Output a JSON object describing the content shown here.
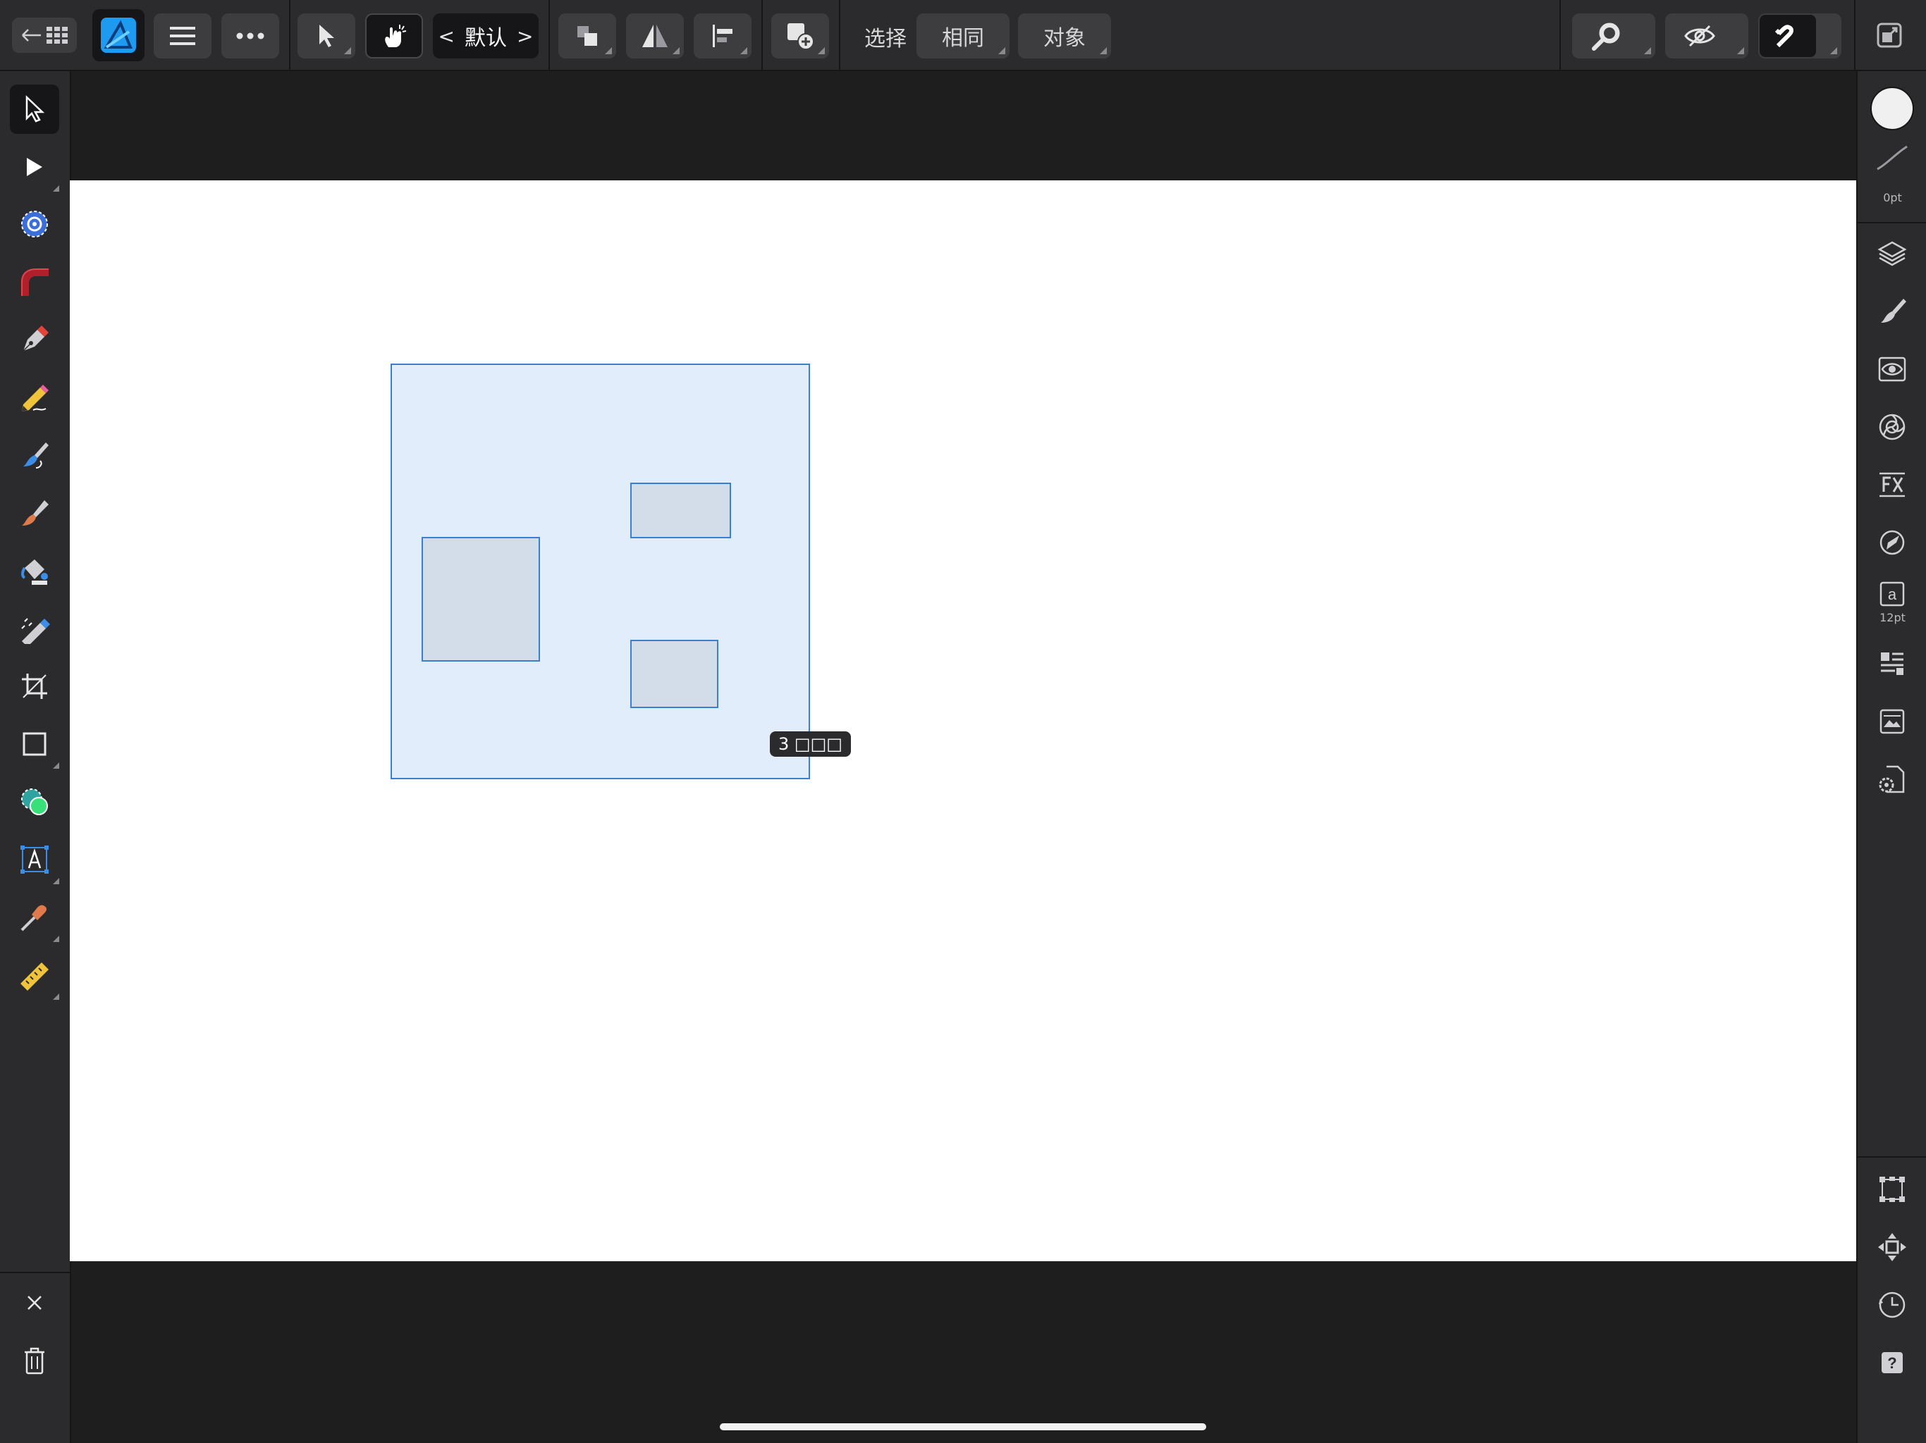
{
  "toolbar": {
    "persona_label": "默认",
    "select_label": "选择",
    "same_label": "相同",
    "object_label": "对象"
  },
  "right_panel": {
    "stroke_width": "0pt",
    "text_size": "12pt"
  },
  "canvas": {
    "selection_badge": "3 □□□"
  },
  "colors": {
    "accent": "#3b7fd0",
    "app_icon": "#1e9bf0",
    "toolbar_bg": "#2b2b2d",
    "canvas_bg": "#ffffff"
  },
  "icons": {
    "top": [
      "back-arrow-icon",
      "grid-icon",
      "affinity-designer-logo-icon",
      "hamburger-menu-icon",
      "more-dots-icon",
      "pointer-icon",
      "touch-gesture-icon",
      "arrange-icon",
      "flip-icon",
      "align-icon",
      "insert-icon",
      "zoom-icon",
      "view-mode-icon",
      "snapping-magnet-icon",
      "fullscreen-icon"
    ],
    "left": [
      "move-tool-icon",
      "node-tool-icon",
      "corner-tool-icon",
      "point-transform-icon",
      "pen-tool-icon",
      "pencil-tool-icon",
      "vector-brush-icon",
      "pixel-brush-icon",
      "fill-tool-icon",
      "transparency-tool-icon",
      "crop-tool-icon",
      "rectangle-tool-icon",
      "shape-builder-icon",
      "text-tool-icon",
      "eyedropper-tool-icon",
      "measure-tool-icon",
      "close-icon",
      "trash-icon"
    ],
    "right": [
      "color-swatch-icon",
      "stroke-icon",
      "layers-icon",
      "brushes-icon",
      "appearance-icon",
      "symbols-icon",
      "fx-icon",
      "navigator-icon",
      "text-style-icon",
      "paragraph-icon",
      "stock-icon",
      "document-settings-icon",
      "transform-icon",
      "move-arrows-icon",
      "history-icon",
      "help-icon"
    ]
  }
}
